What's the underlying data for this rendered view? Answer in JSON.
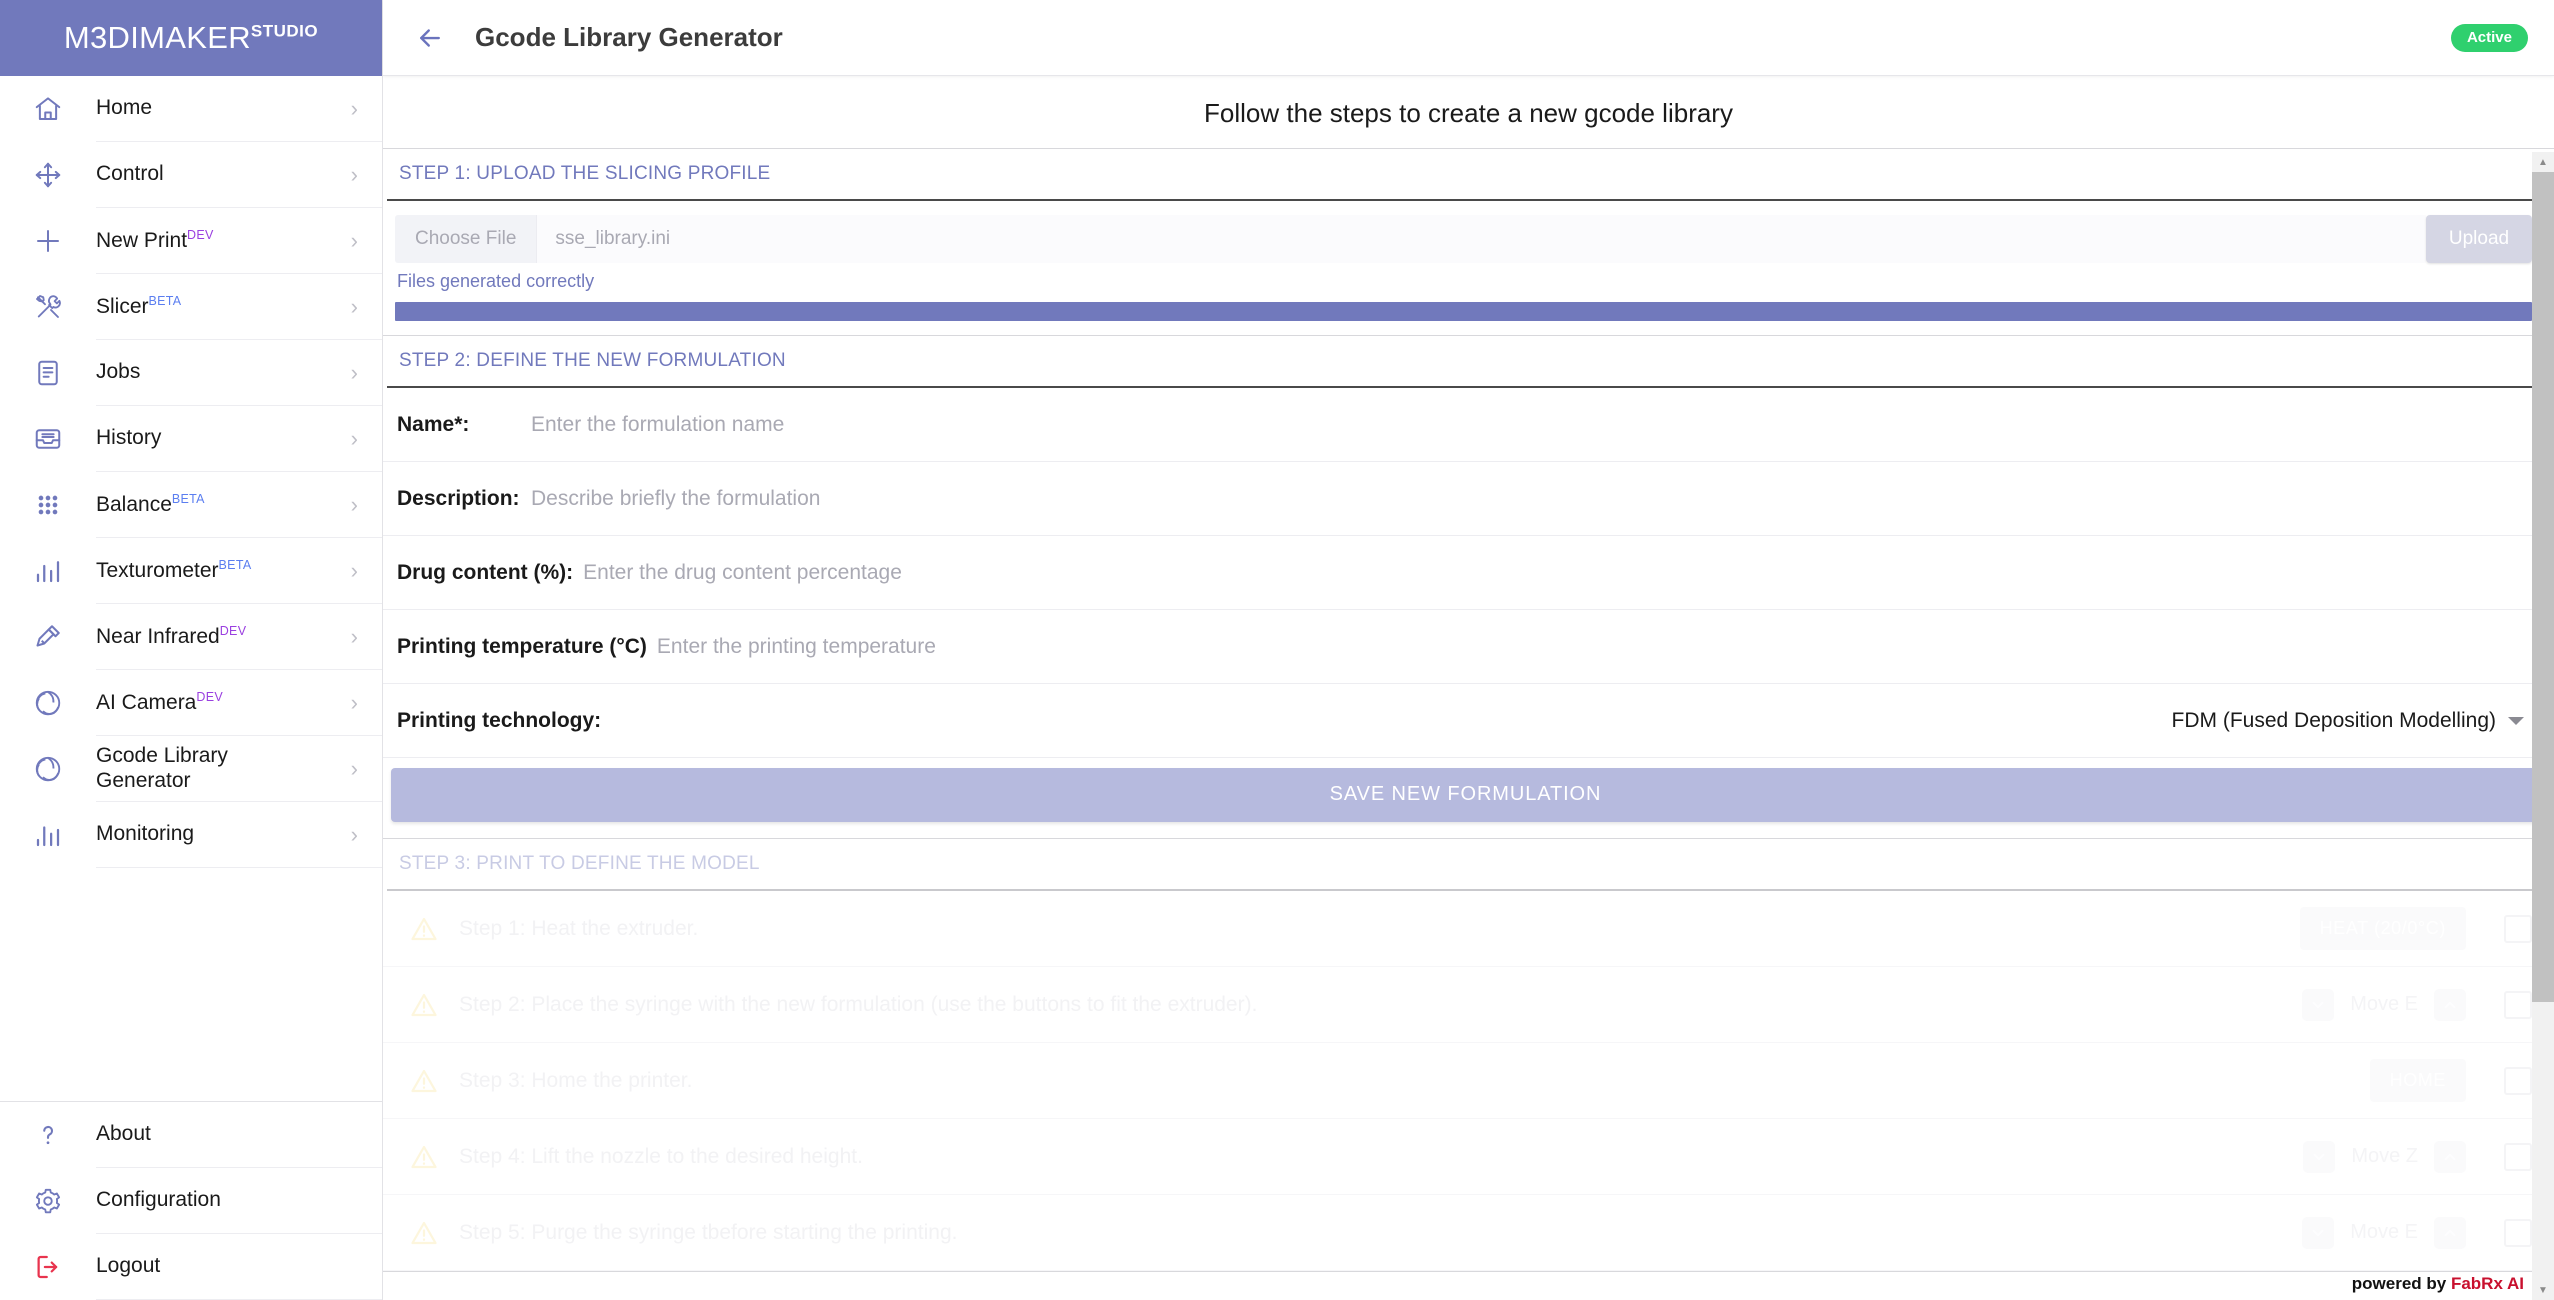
{
  "brand": {
    "name": "M3DIMAKER",
    "sup": "STUDIO"
  },
  "sidebar": {
    "items": [
      {
        "label": "Home",
        "tag": "",
        "icon": "home-icon"
      },
      {
        "label": "Control",
        "tag": "",
        "icon": "move-icon"
      },
      {
        "label": "New Print",
        "tag": "DEV",
        "icon": "plus-icon"
      },
      {
        "label": "Slicer",
        "tag": "BETA",
        "icon": "tools-icon"
      },
      {
        "label": "Jobs",
        "tag": "",
        "icon": "document-icon"
      },
      {
        "label": "History",
        "tag": "",
        "icon": "inbox-icon"
      },
      {
        "label": "Balance",
        "tag": "BETA",
        "icon": "grid-dots-icon"
      },
      {
        "label": "Texturometer",
        "tag": "BETA",
        "icon": "bar-chart-icon"
      },
      {
        "label": "Near Infrared",
        "tag": "DEV",
        "icon": "flashlight-icon"
      },
      {
        "label": "AI Camera",
        "tag": "DEV",
        "icon": "aperture-icon"
      },
      {
        "label": "Gcode Library Generator",
        "tag": "",
        "icon": "aperture-icon"
      },
      {
        "label": "Monitoring",
        "tag": "",
        "icon": "bar-chart-icon"
      }
    ],
    "bottom_items": [
      {
        "label": "About",
        "icon": "question-icon"
      },
      {
        "label": "Configuration",
        "icon": "gear-icon"
      },
      {
        "label": "Logout",
        "icon": "logout-icon"
      }
    ],
    "chevron": "›"
  },
  "topbar": {
    "back_icon": "arrow-left-icon",
    "title": "Gcode Library Generator",
    "status": "Active"
  },
  "main": {
    "intro": "Follow the steps to create a new gcode library",
    "step1": {
      "header": "STEP 1: UPLOAD THE SLICING PROFILE",
      "choose_file_label": "Choose File",
      "file_name": "sse_library.ini",
      "upload_label": "Upload",
      "status_message": "Files generated correctly",
      "progress_percent": 100
    },
    "step2": {
      "header": "STEP 2: DEFINE THE NEW FORMULATION",
      "fields": [
        {
          "label": "Name*:",
          "placeholder": "Enter the formulation name",
          "value": ""
        },
        {
          "label": "Description:",
          "placeholder": "Describe briefly the formulation",
          "value": ""
        },
        {
          "label": "Drug content (%):",
          "placeholder": "Enter the drug content percentage",
          "value": ""
        },
        {
          "label": "Printing temperature (°C)",
          "placeholder": "Enter the printing temperature",
          "value": ""
        }
      ],
      "technology_label": "Printing technology:",
      "technology_value": "FDM (Fused Deposition Modelling)",
      "save_label": "SAVE NEW FORMULATION"
    },
    "step3": {
      "header": "STEP 3: PRINT TO DEFINE THE MODEL",
      "rows": [
        {
          "text": "Step 1: Heat the extruder.",
          "control": "button",
          "button_label": "HEAT (20/0°C)"
        },
        {
          "text": "Step 2: Place the syringe with the new formulation (use the buttons to fit the extruder).",
          "control": "stepper",
          "stepper_label": "Move E"
        },
        {
          "text": "Step 3: Home the printer.",
          "control": "button",
          "button_label": "HOME"
        },
        {
          "text": "Step 4: Lift the nozzle to the desired height.",
          "control": "stepper",
          "stepper_label": "Move Z"
        },
        {
          "text": "Step 5: Purge the syringe tbefore starting the printing.",
          "control": "stepper",
          "stepper_label": "Move E"
        }
      ]
    }
  },
  "footer": {
    "powered_prefix": "powered by ",
    "powered_brand": "FabRx AI"
  },
  "colors": {
    "brand_purple": "#7179bc",
    "accent_green": "#2fd06e",
    "save_button": "#b6bade",
    "beta_tag": "#5b7ef0",
    "dev_tag": "#9a3fe0",
    "logout_red": "#e8344e"
  }
}
